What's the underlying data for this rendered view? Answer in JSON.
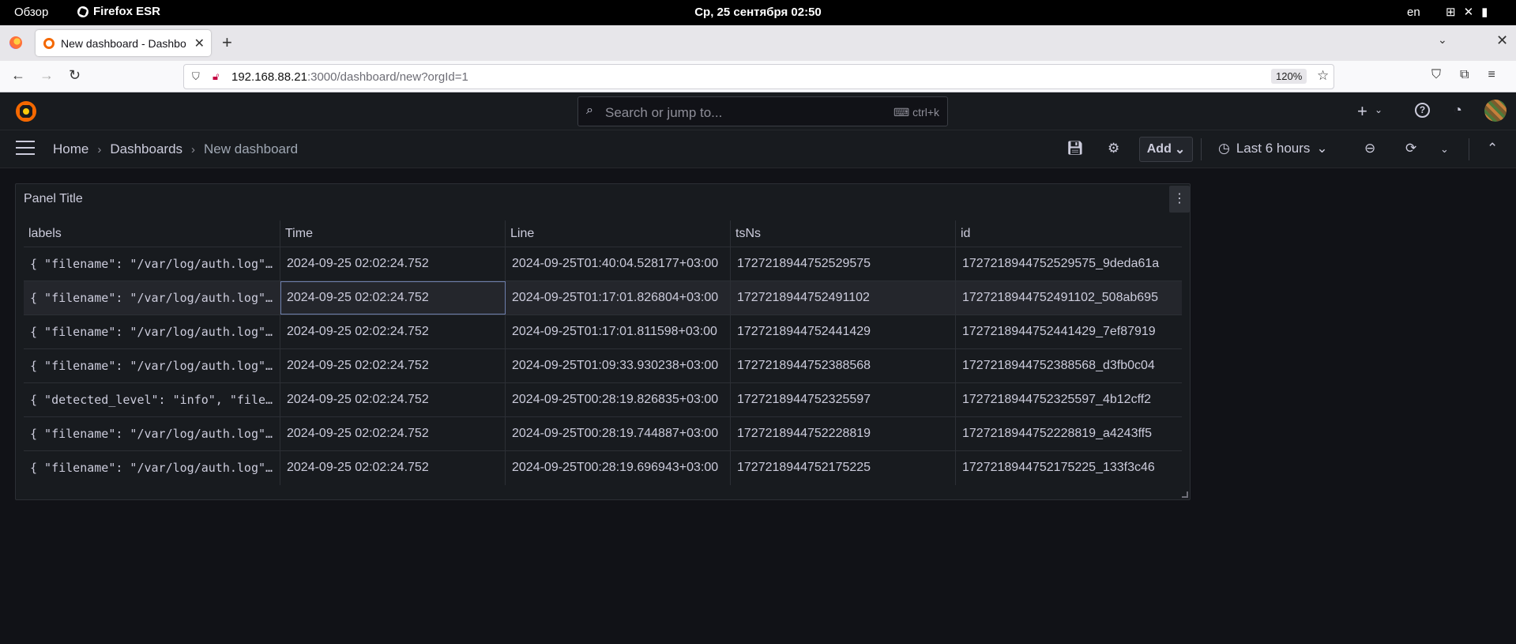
{
  "system": {
    "activities": "Обзор",
    "app_name": "Firefox ESR",
    "clock": "Ср, 25 сентября  02:50",
    "lang": "en"
  },
  "browser": {
    "tab_title": "New dashboard - Dashbo",
    "url_host": "192.168.88.21",
    "url_rest": ":3000/dashboard/new?orgId=1",
    "zoom": "120%"
  },
  "grafana": {
    "search_placeholder": "Search or jump to...",
    "search_shortcut": "ctrl+k",
    "breadcrumbs": [
      "Home",
      "Dashboards",
      "New dashboard"
    ],
    "add_label": "Add",
    "time_range": "Last 6 hours",
    "accent_color": "#f46800"
  },
  "panel": {
    "title": "Panel Title",
    "columns": [
      "labels",
      "Time",
      "Line",
      "tsNs",
      "id"
    ],
    "rows": [
      [
        "{ \"filename\": \"/var/log/auth.log\", \"job\": \"varlogs\" }",
        "2024-09-25 02:02:24.752",
        "2024-09-25T01:40:04.528177+03:00",
        "1727218944752529575",
        "1727218944752529575_9deda61a"
      ],
      [
        "{ \"filename\": \"/var/log/auth.log\", \"job\": \"varlogs\" }",
        "2024-09-25 02:02:24.752",
        "2024-09-25T01:17:01.826804+03:00",
        "1727218944752491102",
        "1727218944752491102_508ab695"
      ],
      [
        "{ \"filename\": \"/var/log/auth.log\", \"job\": \"varlogs\" }",
        "2024-09-25 02:02:24.752",
        "2024-09-25T01:17:01.811598+03:00",
        "1727218944752441429",
        "1727218944752441429_7ef87919"
      ],
      [
        "{ \"filename\": \"/var/log/auth.log\", \"job\": \"varlogs\" }",
        "2024-09-25 02:02:24.752",
        "2024-09-25T01:09:33.930238+03:00",
        "1727218944752388568",
        "1727218944752388568_d3fb0c04"
      ],
      [
        "{ \"detected_level\": \"info\", \"filename\": \"/var/log/syslog\" }",
        "2024-09-25 02:02:24.752",
        "2024-09-25T00:28:19.826835+03:00",
        "1727218944752325597",
        "1727218944752325597_4b12cff2"
      ],
      [
        "{ \"filename\": \"/var/log/auth.log\", \"job\": \"varlogs\" }",
        "2024-09-25 02:02:24.752",
        "2024-09-25T00:28:19.744887+03:00",
        "1727218944752228819",
        "1727218944752228819_a4243ff5"
      ],
      [
        "{ \"filename\": \"/var/log/auth.log\", \"job\": \"varlogs\" }",
        "2024-09-25 02:02:24.752",
        "2024-09-25T00:28:19.696943+03:00",
        "1727218944752175225",
        "1727218944752175225_133f3c46"
      ]
    ]
  }
}
